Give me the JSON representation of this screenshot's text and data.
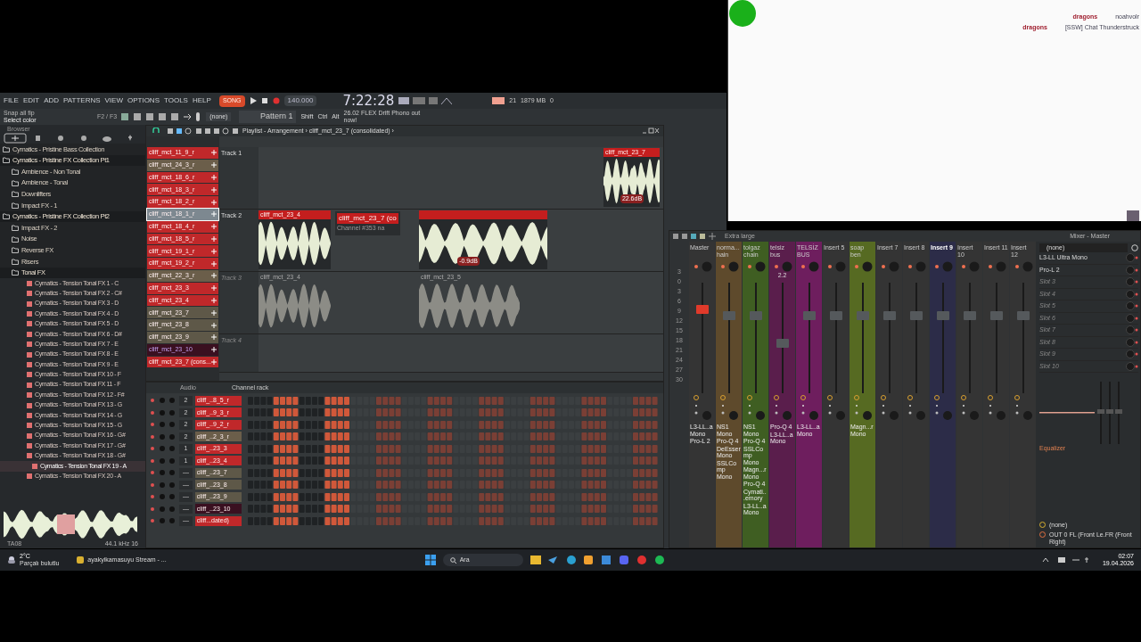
{
  "menu": [
    "FILE",
    "EDIT",
    "ADD",
    "PATTERNS",
    "VIEW",
    "OPTIONS",
    "TOOLS",
    "HELP"
  ],
  "transport": {
    "mode": "SONG",
    "tempo": "140.000",
    "time": "7:22:28",
    "cpu": "21",
    "memory": "1879 MB",
    "voices": "0"
  },
  "hint": {
    "line_1": "Snap all fip",
    "line_2": "Select color",
    "pages": "F2 / F3"
  },
  "toolbar": {
    "pattern": "Pattern 1",
    "modifiers": [
      "Shift",
      "Ctrl",
      "Alt"
    ],
    "channel": "(none)",
    "news": "26.02 FLEX Drift Phono out now!"
  },
  "browser": {
    "title": "Browser",
    "items": [
      {
        "label": "Cymatics - Pristine Bass Collection",
        "kind": "folder",
        "expanded": false
      },
      {
        "label": "Cymatics - Pristine FX Collection Pt1",
        "kind": "folder",
        "expanded": true,
        "children": [
          {
            "label": "Ambience - Non Tonal",
            "kind": "folder",
            "expanded": false
          },
          {
            "label": "Ambience - Tonal",
            "kind": "folder",
            "expanded": false
          },
          {
            "label": "Downlifters",
            "kind": "folder",
            "expanded": false
          },
          {
            "label": "Impact FX - 1",
            "kind": "folder",
            "expanded": false
          }
        ]
      },
      {
        "label": "Cymatics - Pristine FX Collection Pt2",
        "kind": "folder",
        "expanded": true,
        "children": [
          {
            "label": "Impact FX - 2",
            "kind": "folder",
            "expanded": false
          },
          {
            "label": "Noise",
            "kind": "folder",
            "expanded": false
          },
          {
            "label": "Reverse FX",
            "kind": "folder",
            "expanded": false
          },
          {
            "label": "Risers",
            "kind": "folder",
            "expanded": false
          },
          {
            "label": "Tonal FX",
            "kind": "folder",
            "expanded": true,
            "children": [
              {
                "label": "Cymatics - Tension Tonal FX 1 - C",
                "kind": "file",
                "selected": false
              },
              {
                "label": "Cymatics - Tension Tonal FX 2 - C#",
                "kind": "file",
                "selected": false
              },
              {
                "label": "Cymatics - Tension Tonal FX 3 - D",
                "kind": "file",
                "selected": false
              },
              {
                "label": "Cymatics - Tension Tonal FX 4 - D",
                "kind": "file",
                "selected": false
              },
              {
                "label": "Cymatics - Tension Tonal FX 5 - D",
                "kind": "file",
                "selected": false
              },
              {
                "label": "Cymatics - Tension Tonal FX 6 - D#",
                "kind": "file",
                "selected": false
              },
              {
                "label": "Cymatics - Tension Tonal FX 7 - E",
                "kind": "file",
                "selected": false
              },
              {
                "label": "Cymatics - Tension Tonal FX 8 - E",
                "kind": "file",
                "selected": false
              },
              {
                "label": "Cymatics - Tension Tonal FX 9 - E",
                "kind": "file",
                "selected": false
              },
              {
                "label": "Cymatics - Tension Tonal FX 10 - F",
                "kind": "file",
                "selected": false
              },
              {
                "label": "Cymatics - Tension Tonal FX 11 - F",
                "kind": "file",
                "selected": false
              },
              {
                "label": "Cymatics - Tension Tonal FX 12 - F#",
                "kind": "file",
                "selected": false
              },
              {
                "label": "Cymatics - Tension Tonal FX 13 - G",
                "kind": "file",
                "selected": false
              },
              {
                "label": "Cymatics - Tension Tonal FX 14 - G",
                "kind": "file",
                "selected": false
              },
              {
                "label": "Cymatics - Tension Tonal FX 15 - G",
                "kind": "file",
                "selected": false
              },
              {
                "label": "Cymatics - Tension Tonal FX 16 - G#",
                "kind": "file",
                "selected": false
              },
              {
                "label": "Cymatics - Tension Tonal FX 17 - G#",
                "kind": "file",
                "selected": false
              },
              {
                "label": "Cymatics - Tension Tonal FX 18 - G#",
                "kind": "file",
                "selected": false
              },
              {
                "label": "Cymatics - Tension Tonal FX 19 - A",
                "kind": "file",
                "selected": true
              },
              {
                "label": "Cymatics - Tension Tonal FX 20 - A",
                "kind": "file",
                "selected": false
              }
            ]
          }
        ]
      }
    ],
    "sample_rate": "44.1 kHz 16",
    "tag": "TA08"
  },
  "playlist": {
    "title": "Playlist - Arrangement › cliff_mct_23_7 (consolidated) ›",
    "clip_picker": [
      {
        "label": "cliff_mct_11_9_r",
        "color": "#c0282a",
        "selected": false
      },
      {
        "label": "cliff_mct_24_3_r",
        "color": "#6b5e4a",
        "selected": false
      },
      {
        "label": "cliff_mct_18_6_r",
        "color": "#c0282a",
        "selected": false
      },
      {
        "label": "cliff_mct_18_3_r",
        "color": "#c0282a",
        "selected": false
      },
      {
        "label": "cliff_mct_18_2_r",
        "color": "#c0282a",
        "selected": false
      },
      {
        "label": "cliff_mct_18_1_r",
        "color": "#7d8890",
        "selected": true
      },
      {
        "label": "cliff_mct_18_4_r",
        "color": "#c0282a",
        "selected": false
      },
      {
        "label": "cliff_mct_18_5_r",
        "color": "#c0282a",
        "selected": false
      },
      {
        "label": "cliff_mct_19_1_r",
        "color": "#c0282a",
        "selected": false
      },
      {
        "label": "cliff_mct_19_2_r",
        "color": "#c0282a",
        "selected": false
      },
      {
        "label": "cliff_mct_22_3_r",
        "color": "#6b5e4a",
        "selected": false
      },
      {
        "label": "cliff_mct_23_3",
        "color": "#c0282a",
        "selected": false
      },
      {
        "label": "cliff_mct_23_4",
        "color": "#c0282a",
        "selected": false
      },
      {
        "label": "cliff_mct_23_7",
        "color": "#5e5848",
        "selected": false
      },
      {
        "label": "cliff_mct_23_8",
        "color": "#5e5848",
        "selected": false
      },
      {
        "label": "cliff_mct_23_9",
        "color": "#5e5848",
        "selected": false
      },
      {
        "label": "cliff_mct_23_10",
        "color": "#3a1020",
        "selected": false
      },
      {
        "label": "cliff_mct_23_7 (cons...",
        "color": "#c0282a",
        "selected": false
      }
    ],
    "tracks": [
      {
        "name": "Track 1",
        "muted": false,
        "clips": [
          {
            "label": "cliff_mct_23_7",
            "gain": "22.6dB"
          }
        ]
      },
      {
        "name": "Track 2",
        "muted": false,
        "clips": [
          {
            "label": "cliff_mct_23_4"
          },
          {
            "gain": "-0.9dB"
          }
        ]
      },
      {
        "name": "Track 3",
        "muted": true,
        "clips": [
          {
            "label": "cliff_mct_23_4"
          },
          {
            "label": "cliff_mct_23_5"
          }
        ]
      },
      {
        "name": "Track 4",
        "muted": true
      }
    ],
    "popup": {
      "label": "cliff_mct_23_7 (co",
      "hint": "Channel #353 na"
    }
  },
  "channel_rack": {
    "title": "Channel rack",
    "group": "Audio",
    "rows": [
      {
        "route": "2",
        "name": "cliff_..8_5_r",
        "color": "#c0282a"
      },
      {
        "route": "2",
        "name": "cliff_..9_3_r",
        "color": "#c0282a"
      },
      {
        "route": "2",
        "name": "cliff_..9_2_r",
        "color": "#c0282a"
      },
      {
        "route": "2",
        "name": "cliff_..2_3_r",
        "color": "#6b5e4a"
      },
      {
        "route": "1",
        "name": "cliff_..23_3",
        "color": "#c0282a"
      },
      {
        "route": "1",
        "name": "cliff_..23_4",
        "color": "#c0282a"
      },
      {
        "route": "—",
        "name": "cliff_..23_7",
        "color": "#5e5848"
      },
      {
        "route": "—",
        "name": "cliff_..23_8",
        "color": "#5e5848"
      },
      {
        "route": "—",
        "name": "cliff_..23_9",
        "color": "#5e5848"
      },
      {
        "route": "—",
        "name": "cliff_..23_10",
        "color": "#3a1020"
      },
      {
        "route": "—",
        "name": "cliff...dated)",
        "color": "#c0282a"
      }
    ]
  },
  "mixer": {
    "size": "Extra large",
    "title": "Mixer - Master",
    "scale": [
      "3",
      "0",
      "3",
      "6",
      "9",
      "12",
      "15",
      "18",
      "21",
      "24",
      "27",
      "30"
    ],
    "strips": [
      {
        "name": "Master",
        "color": "#343434",
        "level": 0.78,
        "selected": false,
        "plugins": [
          "L3-LL..a Mono",
          "Pro-L 2"
        ]
      },
      {
        "name": "norma...hain",
        "color": "#5e4a2c",
        "level": 0.72,
        "selected": false,
        "plugins": [
          "NS1 Mono",
          "Pro-Q 4",
          "DeEsser Mono",
          "SSLComp Mono"
        ]
      },
      {
        "name": "tolgaz chain",
        "color": "#3f5e22",
        "level": 0.72,
        "selected": false,
        "plugins": [
          "NS1 Mono",
          "Pro-Q 4",
          "SSLComp Mono",
          "Magn...r Mono",
          "Pro-Q 4",
          "Cymati...emory",
          "L3-LL..a Mono"
        ]
      },
      {
        "name": "telsiz bus",
        "color": "#5a1e4c",
        "level": 0.45,
        "selected": false,
        "reading": "2.2",
        "plugins": [
          "Pro-Q 4",
          "L3-LL..a Mono"
        ]
      },
      {
        "name": "TELSİZ BUS",
        "color": "#6e1e5e",
        "level": 0.72,
        "selected": false,
        "plugins": [
          "L3-LL..a Mono"
        ]
      },
      {
        "name": "Insert 5",
        "color": "#343434",
        "level": 0.72,
        "selected": false
      },
      {
        "name": "soap ben",
        "color": "#566a22",
        "level": 0.72,
        "selected": false,
        "plugins": [
          "Magn...r Mono"
        ]
      },
      {
        "name": "Insert 7",
        "color": "#343434",
        "level": 0.72,
        "selected": false
      },
      {
        "name": "Insert 8",
        "color": "#343434",
        "level": 0.72,
        "selected": false
      },
      {
        "name": "Insert 9",
        "color": "#2c2c48",
        "level": 0.72,
        "selected": true
      },
      {
        "name": "Insert 10",
        "color": "#343434",
        "level": 0.72,
        "selected": false
      },
      {
        "name": "Insert 11",
        "color": "#343434",
        "level": 0.72,
        "selected": false
      },
      {
        "name": "Insert 12",
        "color": "#343434",
        "level": 0.72,
        "selected": false
      }
    ],
    "preset": "(none)",
    "slots": [
      {
        "label": "L3-LL Ultra Mono",
        "kind": "plugin"
      },
      {
        "label": "Pro-L 2",
        "kind": "plugin"
      },
      {
        "label": "Slot 3",
        "kind": "empty"
      },
      {
        "label": "Slot 4",
        "kind": "empty"
      },
      {
        "label": "Slot 5",
        "kind": "empty"
      },
      {
        "label": "Slot 6",
        "kind": "empty"
      },
      {
        "label": "Slot 7",
        "kind": "empty"
      },
      {
        "label": "Slot 8",
        "kind": "empty"
      },
      {
        "label": "Slot 9",
        "kind": "empty"
      },
      {
        "label": "Slot 10",
        "kind": "empty"
      }
    ],
    "eq_label": "Equalizer",
    "input": "(none)",
    "output": "OUT 0 FL (Front Le.FR (Front Right)"
  },
  "chat": [
    {
      "user": "dragons",
      "text": "noahvolr"
    },
    {
      "user": "dragons",
      "text": "[SSW] Chat Thunderstruck"
    }
  ],
  "taskbar": {
    "temperature": "2°C",
    "weather": "Parçalı bulutlu",
    "app": "ayakyikamasuyu Stream - ...",
    "search": "Ara",
    "time": "02:07",
    "date": "19.04.2026"
  }
}
